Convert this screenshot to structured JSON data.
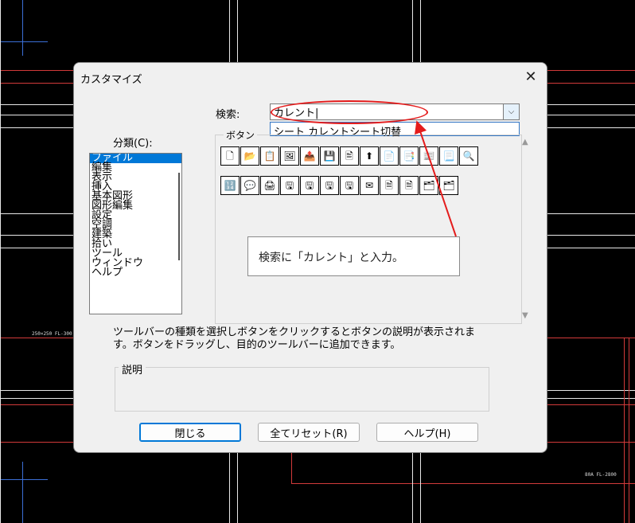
{
  "dialog": {
    "title": "カスタマイズ",
    "close_glyph": "✕",
    "search_label": "検索:",
    "search_value": "カレント|",
    "search_dropdown_glyph": "⌵",
    "suggestion": "シート カレントシート切替",
    "category_label": "分類(C):",
    "categories": [
      "ファイル",
      "編集",
      "表示",
      "挿入",
      "基本図形",
      "図形編集",
      "設定",
      "空調",
      "建築",
      "拾い",
      "ツール",
      "ウィンドウ",
      "ヘルプ"
    ],
    "buttons_group_label": "ボタン",
    "toolbar_row1": [
      "🗋",
      "📂",
      "📋",
      "🖼",
      "📤",
      "💾",
      "🖹",
      "⬆",
      "📄",
      "📑",
      "📰",
      "📃",
      "🔍"
    ],
    "toolbar_row2": [
      "🔢",
      "💬",
      "🖨",
      "🖫",
      "🖫",
      "🖫",
      "🖫",
      "✉",
      "🗎",
      "🗎",
      "🗂",
      "🗂"
    ],
    "callout_text": "検索に「カレント」と入力。",
    "help_text": "ツールバーの種類を選択しボタンをクリックするとボタンの説明が表示されます。ボタンをドラッグし、目的のツールバーに追加できます。",
    "description_label": "説明",
    "close_button": "閉じる",
    "reset_button": "全てリセット(R)",
    "help_button": "ヘルプ(H)"
  },
  "cad": {
    "tag_left": "250×250 FL-300",
    "tag_right": "80A FL-2800"
  },
  "colors": {
    "selection": "#0078d7",
    "annotation_red": "#e41c1c"
  }
}
